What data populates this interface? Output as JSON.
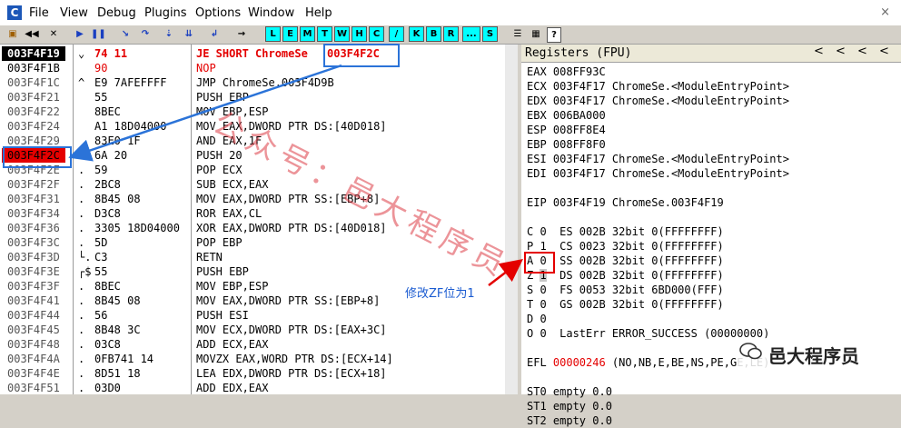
{
  "menu": {
    "app_icon": "C",
    "items": [
      "File",
      "View",
      "Debug",
      "Plugins",
      "Options",
      "Window",
      "Help"
    ],
    "close": "×"
  },
  "toolbar": {
    "letters": [
      "L",
      "E",
      "M",
      "T",
      "W",
      "H",
      "C",
      "/",
      "K",
      "B",
      "R",
      "...",
      "S"
    ],
    "help": "?"
  },
  "disasm": {
    "rows": [
      {
        "addr": "003F4F19",
        "mk": "⌄",
        "hex": "74 11",
        "dis": "JE SHORT ChromeSe",
        "cmt": "003F4F2C",
        "state": "current"
      },
      {
        "addr": "003F4F1B",
        "mk": "",
        "hex": "90",
        "dis": "NOP",
        "cmt": "",
        "state": "patched"
      },
      {
        "addr": "003F4F1C",
        "mk": "^",
        "hex": "E9 7AFEFFFF",
        "dis": "JMP ChromeSe.003F4D9B",
        "cmt": "",
        "state": ""
      },
      {
        "addr": "003F4F21",
        "mk": "",
        "hex": "55",
        "dis": "PUSH EBP",
        "cmt": "",
        "state": ""
      },
      {
        "addr": "003F4F22",
        "mk": "",
        "hex": "8BEC",
        "dis": "MOV EBP,ESP",
        "cmt": "",
        "state": ""
      },
      {
        "addr": "003F4F24",
        "mk": "",
        "hex": "A1 18D04000",
        "dis": "MOV EAX,DWORD PTR DS:[40D018]",
        "cmt": "",
        "state": ""
      },
      {
        "addr": "003F4F29",
        "mk": "",
        "hex": "83E0 1F",
        "dis": "AND EAX,1F",
        "cmt": "",
        "state": ""
      },
      {
        "addr": "003F4F2C",
        "mk": "",
        "hex": "6A 20",
        "dis": "PUSH 20",
        "cmt": "",
        "state": "target"
      },
      {
        "addr": "003F4F2E",
        "mk": ".",
        "hex": "59",
        "dis": "POP ECX",
        "cmt": "",
        "state": ""
      },
      {
        "addr": "003F4F2F",
        "mk": ".",
        "hex": "2BC8",
        "dis": "SUB ECX,EAX",
        "cmt": "",
        "state": ""
      },
      {
        "addr": "003F4F31",
        "mk": ".",
        "hex": "8B45 08",
        "dis": "MOV EAX,DWORD PTR SS:[EBP+8]",
        "cmt": "",
        "state": ""
      },
      {
        "addr": "003F4F34",
        "mk": ".",
        "hex": "D3C8",
        "dis": "ROR EAX,CL",
        "cmt": "",
        "state": ""
      },
      {
        "addr": "003F4F36",
        "mk": ".",
        "hex": "3305 18D04000",
        "dis": "XOR EAX,DWORD PTR DS:[40D018]",
        "cmt": "",
        "state": ""
      },
      {
        "addr": "003F4F3C",
        "mk": ".",
        "hex": "5D",
        "dis": "POP EBP",
        "cmt": "",
        "state": ""
      },
      {
        "addr": "003F4F3D",
        "mk": "└.",
        "hex": "C3",
        "dis": "RETN",
        "cmt": "",
        "state": ""
      },
      {
        "addr": "003F4F3E",
        "mk": "┌$",
        "hex": "55",
        "dis": "PUSH EBP",
        "cmt": "",
        "state": ""
      },
      {
        "addr": "003F4F3F",
        "mk": ".",
        "hex": "8BEC",
        "dis": "MOV EBP,ESP",
        "cmt": "",
        "state": ""
      },
      {
        "addr": "003F4F41",
        "mk": ".",
        "hex": "8B45 08",
        "dis": "MOV EAX,DWORD PTR SS:[EBP+8]",
        "cmt": "",
        "state": ""
      },
      {
        "addr": "003F4F44",
        "mk": ".",
        "hex": "56",
        "dis": "PUSH ESI",
        "cmt": "",
        "state": ""
      },
      {
        "addr": "003F4F45",
        "mk": ".",
        "hex": "8B48 3C",
        "dis": "MOV ECX,DWORD PTR DS:[EAX+3C]",
        "cmt": "",
        "state": ""
      },
      {
        "addr": "003F4F48",
        "mk": ".",
        "hex": "03C8",
        "dis": "ADD ECX,EAX",
        "cmt": "",
        "state": ""
      },
      {
        "addr": "003F4F4A",
        "mk": ".",
        "hex": "0FB741 14",
        "dis": "MOVZX EAX,WORD PTR DS:[ECX+14]",
        "cmt": "",
        "state": ""
      },
      {
        "addr": "003F4F4E",
        "mk": ".",
        "hex": "8D51 18",
        "dis": "LEA EDX,DWORD PTR DS:[ECX+18]",
        "cmt": "",
        "state": ""
      },
      {
        "addr": "003F4F51",
        "mk": ".",
        "hex": "03D0",
        "dis": "ADD EDX,EAX",
        "cmt": "",
        "state": ""
      }
    ]
  },
  "registers": {
    "title": "Registers (FPU)",
    "nav": [
      "<",
      "<",
      "<",
      "<"
    ],
    "lines": [
      "EAX 008FF93C",
      "ECX 003F4F17 ChromeSe.<ModuleEntryPoint>",
      "EDX 003F4F17 ChromeSe.<ModuleEntryPoint>",
      "EBX 006BA000",
      "ESP 008FF8E4",
      "EBP 008FF8F0",
      "ESI 003F4F17 ChromeSe.<ModuleEntryPoint>",
      "EDI 003F4F17 ChromeSe.<ModuleEntryPoint>",
      "",
      "EIP 003F4F19 ChromeSe.003F4F19",
      "",
      "C 0  ES 002B 32bit 0(FFFFFFFF)",
      "P 1  CS 0023 32bit 0(FFFFFFFF)",
      "A 0  SS 002B 32bit 0(FFFFFFFF)",
      "Z 1  DS 002B 32bit 0(FFFFFFFF)",
      "S 0  FS 0053 32bit 6BD000(FFF)",
      "T 0  GS 002B 32bit 0(FFFFFFFF)",
      "D 0",
      "O 0  LastErr ERROR_SUCCESS (00000000)",
      "",
      "EFL 00000246 (NO,NB,E,BE,NS,PE,GE,LE)",
      "",
      "ST0 empty 0.0",
      "ST1 empty 0.0",
      "ST2 empty 0.0"
    ],
    "efl_prefix": "EFL ",
    "efl_value": "00000246",
    "efl_suffix": " (NO,NB,E,BE,NS,PE,GE,LE)"
  },
  "annotation": {
    "text": "修改ZF位为1",
    "watermark": "公众号：邑大程序员",
    "logo": "邑大程序员"
  },
  "colors": {
    "accent_blue": "#2b73d8",
    "highlight_red": "#e40000",
    "toolbar_cyan": "#00ffff"
  }
}
